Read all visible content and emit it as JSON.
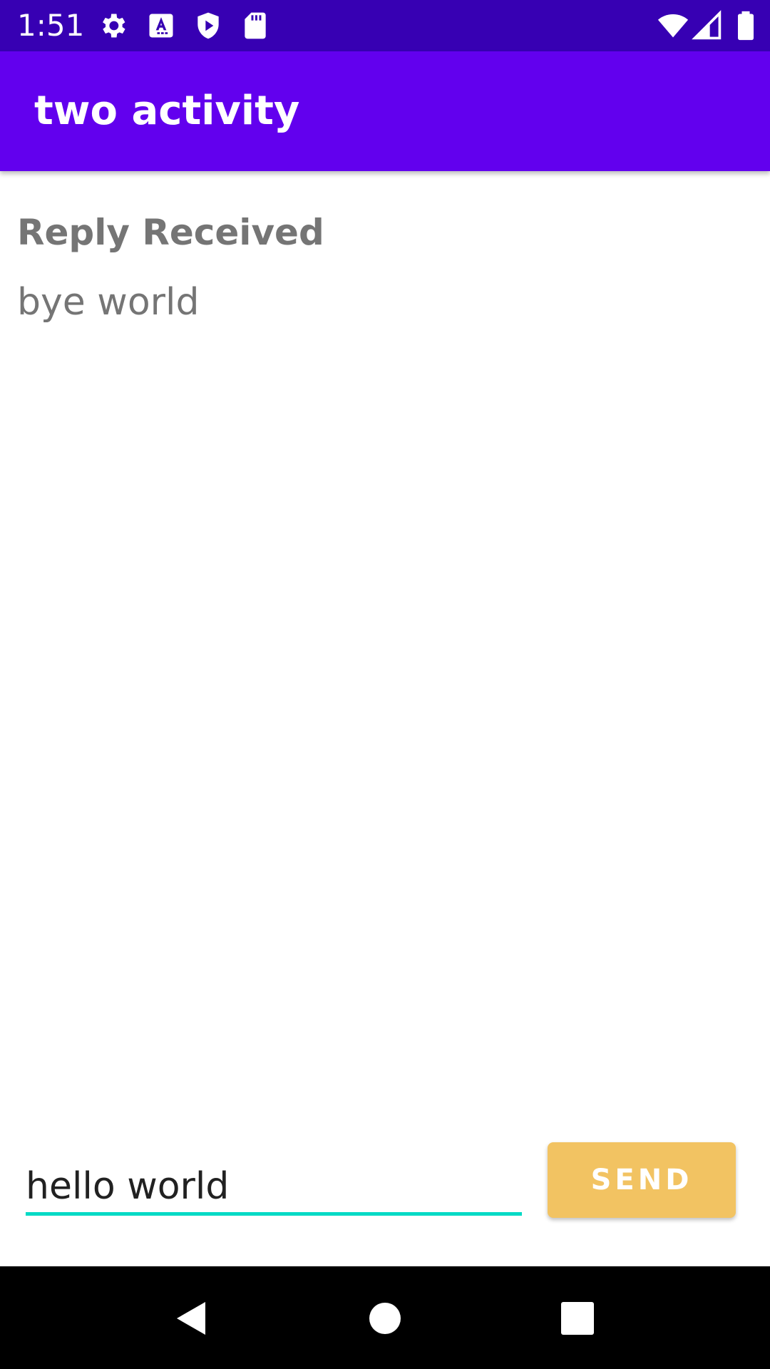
{
  "status_bar": {
    "time": "1:51",
    "icons": [
      "gear-icon",
      "text-a-icon",
      "shield-play-icon",
      "sd-card-icon",
      "wifi-icon",
      "signal-icon",
      "battery-icon"
    ],
    "background": "#3700B3"
  },
  "app_bar": {
    "title": "two activity",
    "background": "#6200EE"
  },
  "content": {
    "reply_header": "Reply Received",
    "reply_text": "bye world"
  },
  "composer": {
    "input_value": "hello world",
    "send_label": "SEND",
    "accent": "#03DAC5",
    "button_color": "#F2C362"
  },
  "nav_bar": {
    "icons": [
      "back-icon",
      "home-icon",
      "recents-icon"
    ]
  }
}
